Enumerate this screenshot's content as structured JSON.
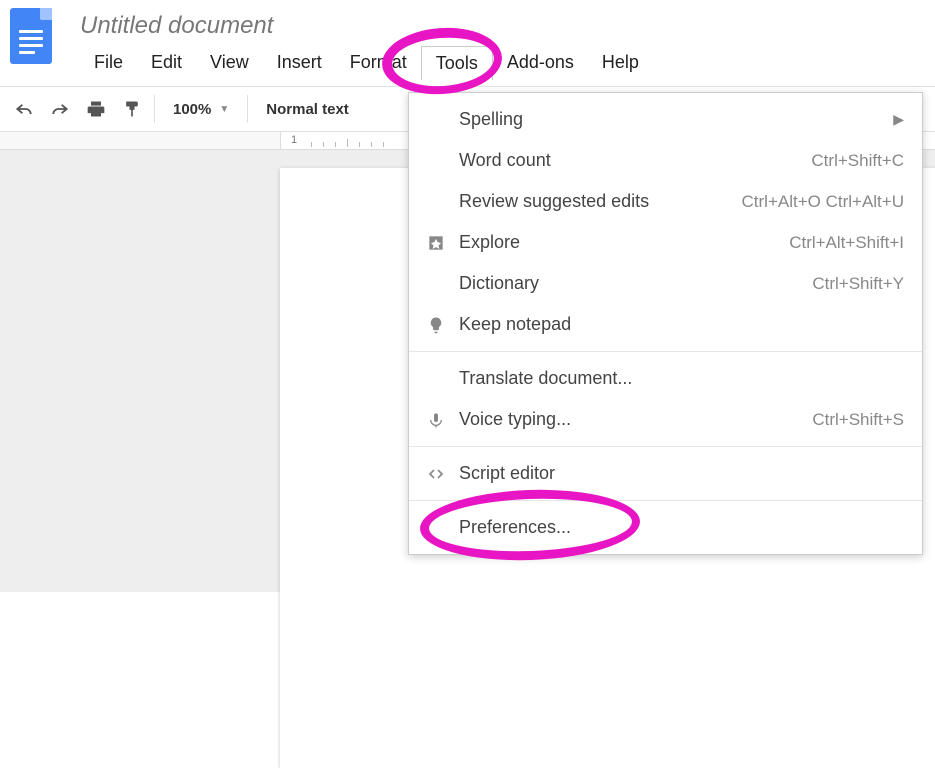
{
  "doc": {
    "title": "Untitled document"
  },
  "menubar": {
    "file": "File",
    "edit": "Edit",
    "view": "View",
    "insert": "Insert",
    "format": "Format",
    "tools": "Tools",
    "addons": "Add-ons",
    "help": "Help"
  },
  "toolbar": {
    "zoom": "100%",
    "style": "Normal text"
  },
  "ruler": {
    "mark": "1"
  },
  "tools_menu": {
    "spelling": {
      "label": "Spelling"
    },
    "word_count": {
      "label": "Word count",
      "shortcut": "Ctrl+Shift+C"
    },
    "review": {
      "label": "Review suggested edits",
      "shortcut": "Ctrl+Alt+O Ctrl+Alt+U"
    },
    "explore": {
      "label": "Explore",
      "shortcut": "Ctrl+Alt+Shift+I"
    },
    "dictionary": {
      "label": "Dictionary",
      "shortcut": "Ctrl+Shift+Y"
    },
    "keep": {
      "label": "Keep notepad"
    },
    "translate": {
      "label": "Translate document..."
    },
    "voice": {
      "label": "Voice typing...",
      "shortcut": "Ctrl+Shift+S"
    },
    "script": {
      "label": "Script editor"
    },
    "prefs": {
      "label": "Preferences..."
    }
  }
}
